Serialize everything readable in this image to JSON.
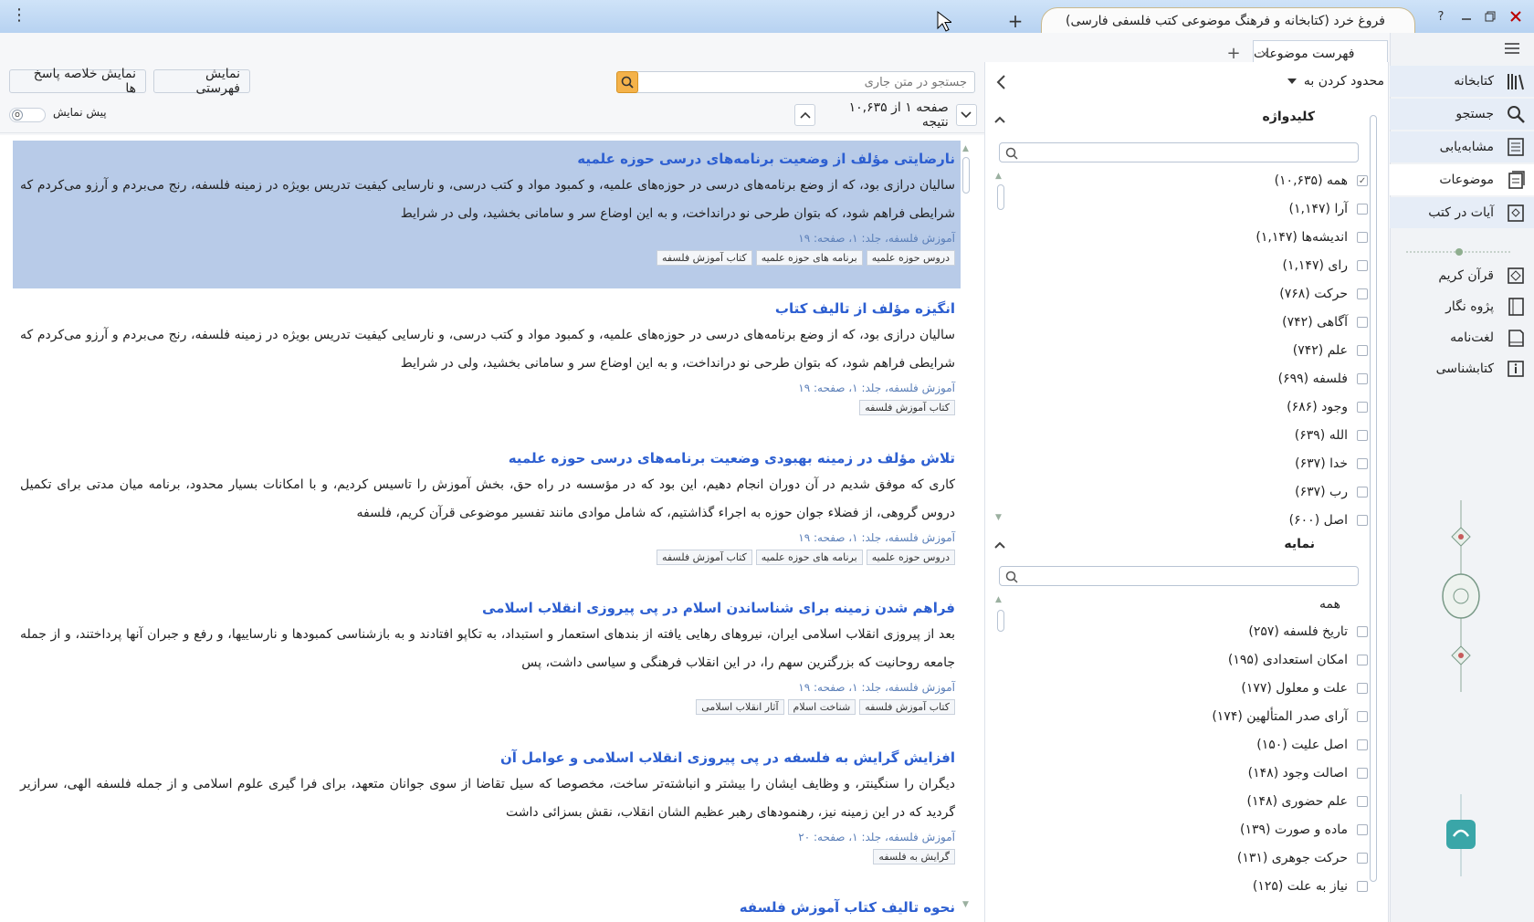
{
  "window": {
    "title": "فروغ خرد (کتابخانه و فرهنگ موضوعی کتب فلسفی فارسی)",
    "controls": [
      "?",
      "minimize",
      "restore",
      "close"
    ]
  },
  "topic_tab": {
    "label": "فهرست موضوعات",
    "close": "×",
    "add": "+"
  },
  "nav": {
    "main_items": [
      {
        "label": "کتابخانه",
        "icon": "books-icon"
      },
      {
        "label": "جستجو",
        "icon": "search-icon"
      },
      {
        "label": "مشابه‌یابی",
        "icon": "similar-doc-icon"
      },
      {
        "label": "موضوعات",
        "icon": "topics-icon"
      },
      {
        "label": "آیات در کتب",
        "icon": "verses-icon"
      }
    ],
    "secondary_items": [
      {
        "label": "قرآن کریم",
        "icon": "quran-icon"
      },
      {
        "label": "پژوه نگار",
        "icon": "notebook-icon"
      },
      {
        "label": "لغت‌نامه",
        "icon": "dictionary-icon"
      },
      {
        "label": "کتابشناسی",
        "icon": "info-icon"
      }
    ]
  },
  "facets": {
    "limit_label": "محدود کردن به",
    "keyword": {
      "title": "کلیدواژه",
      "items": [
        {
          "label": "همه (۱۰,۶۳۵)",
          "checked": true
        },
        {
          "label": "آرا (۱,۱۴۷)",
          "checked": false
        },
        {
          "label": "اندیشه‌ها (۱,۱۴۷)",
          "checked": false
        },
        {
          "label": "رای (۱,۱۴۷)",
          "checked": false
        },
        {
          "label": "حرکت (۷۶۸)",
          "checked": false
        },
        {
          "label": "آگاهی (۷۴۲)",
          "checked": false
        },
        {
          "label": "علم (۷۴۲)",
          "checked": false
        },
        {
          "label": "فلسفه (۶۹۹)",
          "checked": false
        },
        {
          "label": "وجود (۶۸۶)",
          "checked": false
        },
        {
          "label": "الله (۶۳۹)",
          "checked": false
        },
        {
          "label": "خدا (۶۳۷)",
          "checked": false
        },
        {
          "label": "رب (۶۳۷)",
          "checked": false
        },
        {
          "label": "اصل (۶۰۰)",
          "checked": false
        }
      ]
    },
    "index": {
      "title": "نمایه",
      "all_label": "همه",
      "items": [
        {
          "label": "تاریخ فلسفه (۲۵۷)",
          "checked": false
        },
        {
          "label": "امکان استعدادی (۱۹۵)",
          "checked": false
        },
        {
          "label": "علت و معلول (۱۷۷)",
          "checked": false
        },
        {
          "label": "آرای صدر المتألهین (۱۷۴)",
          "checked": false
        },
        {
          "label": "اصل علیت (۱۵۰)",
          "checked": false
        },
        {
          "label": "اصالت وجود (۱۴۸)",
          "checked": false
        },
        {
          "label": "علم حضوری (۱۴۸)",
          "checked": false
        },
        {
          "label": "ماده و صورت (۱۳۹)",
          "checked": false
        },
        {
          "label": "حرکت جوهری (۱۳۱)",
          "checked": false
        },
        {
          "label": "نیاز به علت (۱۲۵)",
          "checked": false
        }
      ]
    }
  },
  "results_header": {
    "search_placeholder": "جستجو در متن جاری",
    "btn_index_view": "نمایش فهرستی",
    "btn_summary_view": "نمایش خلاصه پاسخ ها",
    "preview_label": "پیش نمایش",
    "preview_on": false,
    "pager_text": "صفحه ۱ از ۱۰,۶۳۵ نتیجه"
  },
  "results": [
    {
      "title": "نارضایتی مؤلف از وضعیت برنامه‌های درسی حوزه علمیه",
      "body": "سالیان درازی بود، که از وضع برنامه‌های درسی در حوزه‌های علمیه، و کمبود مواد و کتب درسی، و نارسایی کیفیت تدریس بویژه در زمینه فلسفه، رنج می‌بردم و آرزو می‌کردم که شرایطی فراهم شود، که بتوان طرحی نو درانداخت، و به این اوضاع سر و سامانی بخشید، ولی در شرایط",
      "meta": "آموزش فلسفه، جلد: ۱، صفحه: ۱۹",
      "tags": [
        "دروس حوزه علمیه",
        "برنامه های حوزه علمیه",
        "کتاب آموزش فلسفه"
      ],
      "highlighted": true
    },
    {
      "title": "انگیزه مؤلف از تالیف کتاب",
      "body": "سالیان درازی بود، که از وضع برنامه‌های درسی در حوزه‌های علمیه، و کمبود مواد و کتب درسی، و نارسایی کیفیت تدریس بویژه در زمینه فلسفه، رنج می‌بردم و آرزو می‌کردم که شرایطی فراهم شود، که بتوان طرحی نو درانداخت، و به این اوضاع سر و سامانی بخشید، ولی در شرایط",
      "meta": "آموزش فلسفه، جلد: ۱، صفحه: ۱۹",
      "tags": [
        "کتاب آموزش فلسفه"
      ],
      "highlighted": false
    },
    {
      "title": "تلاش مؤلف در زمینه بهبودی وضعیت برنامه‌های درسی حوزه علمیه",
      "body": "کاری که موفق شدیم در آن دوران انجام دهیم، این بود که در مؤسسه در راه حق، بخش آموزش را تاسیس کردیم، و با امکانات بسیار محدود، برنامه میان مدتی برای تکمیل دروس گروهی، از فضلاء جوان حوزه به اجراء گذاشتیم، که شامل موادی مانند تفسیر موضوعی قرآن کریم، فلسفه",
      "meta": "آموزش فلسفه، جلد: ۱، صفحه: ۱۹",
      "tags": [
        "دروس حوزه علمیه",
        "برنامه های حوزه علمیه",
        "کتاب آموزش فلسفه"
      ],
      "highlighted": false
    },
    {
      "title": "فراهم شدن زمینه برای شناساندن اسلام در پی پیروزی انقلاب اسلامی",
      "body": "بعد از پیروزی انقلاب اسلامی ایران، نیروهای رهایی یافته از بندهای استعمار و استبداد، به تکاپو افتادند و به بازشناسی کمبودها و نارساییها، و رفع و جبران آنها پرداختند، و از جمله جامعه روحانیت که بزرگترین سهم را، در این انقلاب فرهنگی و سیاسی داشت، پس",
      "meta": "آموزش فلسفه، جلد: ۱، صفحه: ۱۹",
      "tags": [
        "کتاب آموزش فلسفه",
        "شناخت اسلام",
        "آثار انقلاب اسلامی"
      ],
      "highlighted": false
    },
    {
      "title": "افزایش گرایش به فلسفه در پی پیروزی انقلاب اسلامی و عوامل آن",
      "body": "دیگران را سنگینتر، و وظایف ایشان را بیشتر و انباشته‌تر ساخت، مخصوصا که سیل تقاضا از سوی جوانان متعهد، برای فرا گیری علوم اسلامی و از جمله فلسفه الهی، سرازیر گردید که در این زمینه نیز، رهنمودهای رهبر عظیم الشان انقلاب، نقش بسزائی داشت",
      "meta": "آموزش فلسفه، جلد: ۱، صفحه: ۲۰",
      "tags": [
        "گرایش به فلسفه"
      ],
      "highlighted": false
    },
    {
      "title": "نحوه تالیف کتاب آموزش فلسفه",
      "body": "",
      "meta": "",
      "tags": [],
      "highlighted": false
    }
  ],
  "colors": {
    "accent": "#2d5fd1",
    "highlight": "#b8cbe8",
    "search_button": "#f4b24a",
    "titlebar": "#c3dbf5"
  }
}
